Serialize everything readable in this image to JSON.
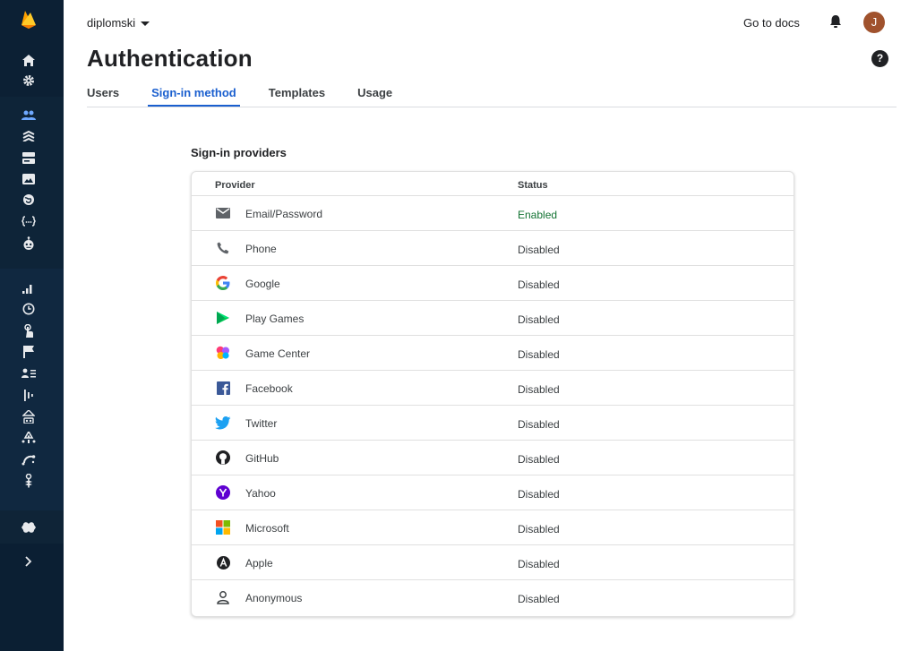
{
  "header": {
    "project_name": "diplomski",
    "docs_label": "Go to docs",
    "avatar_initial": "J"
  },
  "page": {
    "title": "Authentication"
  },
  "tabs": [
    {
      "label": "Users"
    },
    {
      "label": "Sign-in method",
      "active": true
    },
    {
      "label": "Templates"
    },
    {
      "label": "Usage"
    }
  ],
  "providers_section": {
    "title": "Sign-in providers",
    "col_provider": "Provider",
    "col_status": "Status"
  },
  "providers": [
    {
      "name": "Email/Password",
      "status": "Enabled",
      "icon": "email-icon"
    },
    {
      "name": "Phone",
      "status": "Disabled",
      "icon": "phone-icon"
    },
    {
      "name": "Google",
      "status": "Disabled",
      "icon": "google-icon"
    },
    {
      "name": "Play Games",
      "status": "Disabled",
      "icon": "play-games-icon"
    },
    {
      "name": "Game Center",
      "status": "Disabled",
      "icon": "game-center-icon"
    },
    {
      "name": "Facebook",
      "status": "Disabled",
      "icon": "facebook-icon"
    },
    {
      "name": "Twitter",
      "status": "Disabled",
      "icon": "twitter-icon"
    },
    {
      "name": "GitHub",
      "status": "Disabled",
      "icon": "github-icon"
    },
    {
      "name": "Yahoo",
      "status": "Disabled",
      "icon": "yahoo-icon"
    },
    {
      "name": "Microsoft",
      "status": "Disabled",
      "icon": "microsoft-icon"
    },
    {
      "name": "Apple",
      "status": "Disabled",
      "icon": "apple-icon"
    },
    {
      "name": "Anonymous",
      "status": "Disabled",
      "icon": "anonymous-icon"
    }
  ],
  "colors": {
    "rail_bg": "#0b1f33",
    "accent": "#1a5fcf",
    "enabled": "#137333"
  }
}
